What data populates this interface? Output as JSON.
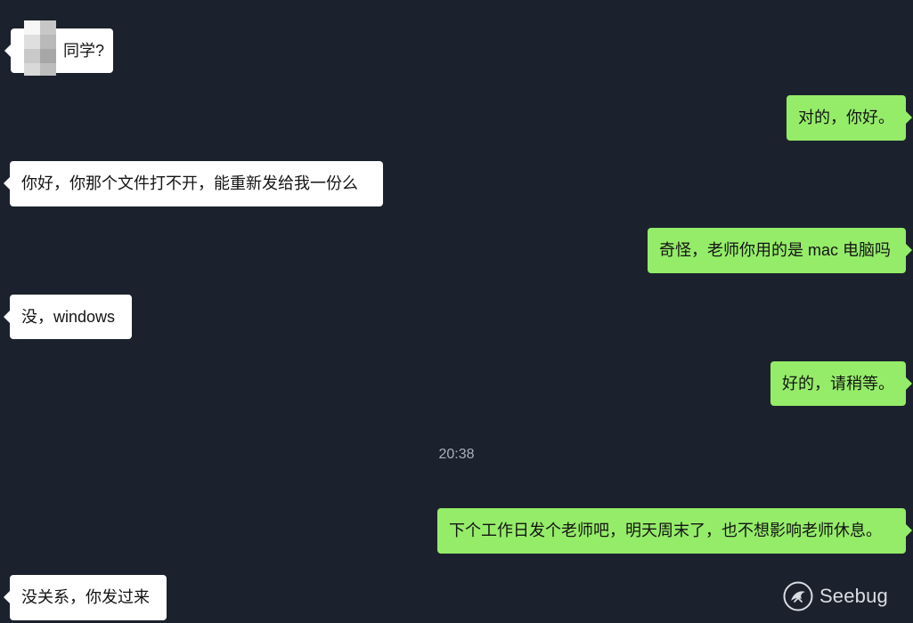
{
  "chat": {
    "messages": [
      {
        "side": "in",
        "text": "同学?",
        "has_blurred_name": true
      },
      {
        "side": "out",
        "text": "对的，你好。"
      },
      {
        "side": "in",
        "text": "你好，你那个文件打不开，能重新发给我一份么"
      },
      {
        "side": "out",
        "text": "奇怪，老师你用的是 mac 电脑吗"
      },
      {
        "side": "in",
        "text": "没，windows"
      },
      {
        "side": "out",
        "text": "好的，请稍等。"
      },
      {
        "side": "out",
        "text": "下个工作日发个老师吧，明天周末了，也不想影响老师休息。"
      },
      {
        "side": "in",
        "text": "没关系，你发过来"
      }
    ],
    "timestamp": "20:38"
  },
  "watermark": {
    "text": "Seebug",
    "icon": "seebug-logo-icon"
  },
  "colors": {
    "background": "#1b222d",
    "incoming_bubble": "#ffffff",
    "outgoing_bubble": "#95ec69",
    "bubble_text": "#141414",
    "timestamp_text": "#a8b0bb",
    "watermark_text": "#e9edf2"
  }
}
